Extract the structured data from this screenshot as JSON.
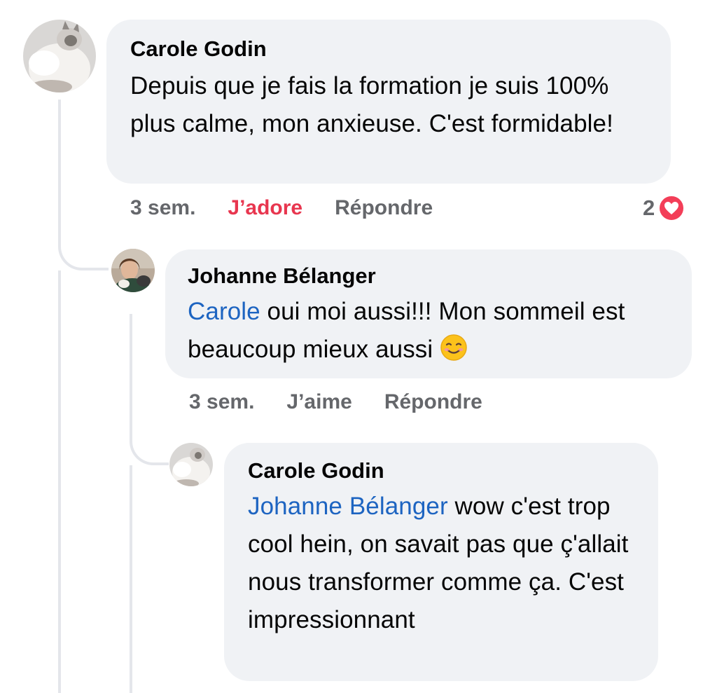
{
  "comments": [
    {
      "author": "Carole Godin",
      "text": "Depuis que je fais la formation je suis 100% plus calme, mon anxieuse. C'est formidable!",
      "time": "3 sem.",
      "like_label": "J’adore",
      "reply_label": "Répondre",
      "reaction_count": "2",
      "reaction_icon": "heart-icon"
    },
    {
      "author": "Johanne Bélanger",
      "mention": "Carole",
      "text": " oui moi aussi!!! Mon sommeil est beaucoup mieux aussi ",
      "emoji": "smiling-face-icon",
      "time": "3 sem.",
      "like_label": "J’aime",
      "reply_label": "Répondre"
    },
    {
      "author": "Carole Godin",
      "mention": "Johanne Bélanger",
      "text": " wow c'est trop cool hein, on savait pas que ç'allait nous transformer comme ça. C'est impressionnant"
    }
  ],
  "colors": {
    "bubble": "#f0f2f5",
    "mention": "#1d64c1",
    "love_action": "#e8364f",
    "heart_badge": "#f33e58",
    "meta_text": "#65676b"
  }
}
